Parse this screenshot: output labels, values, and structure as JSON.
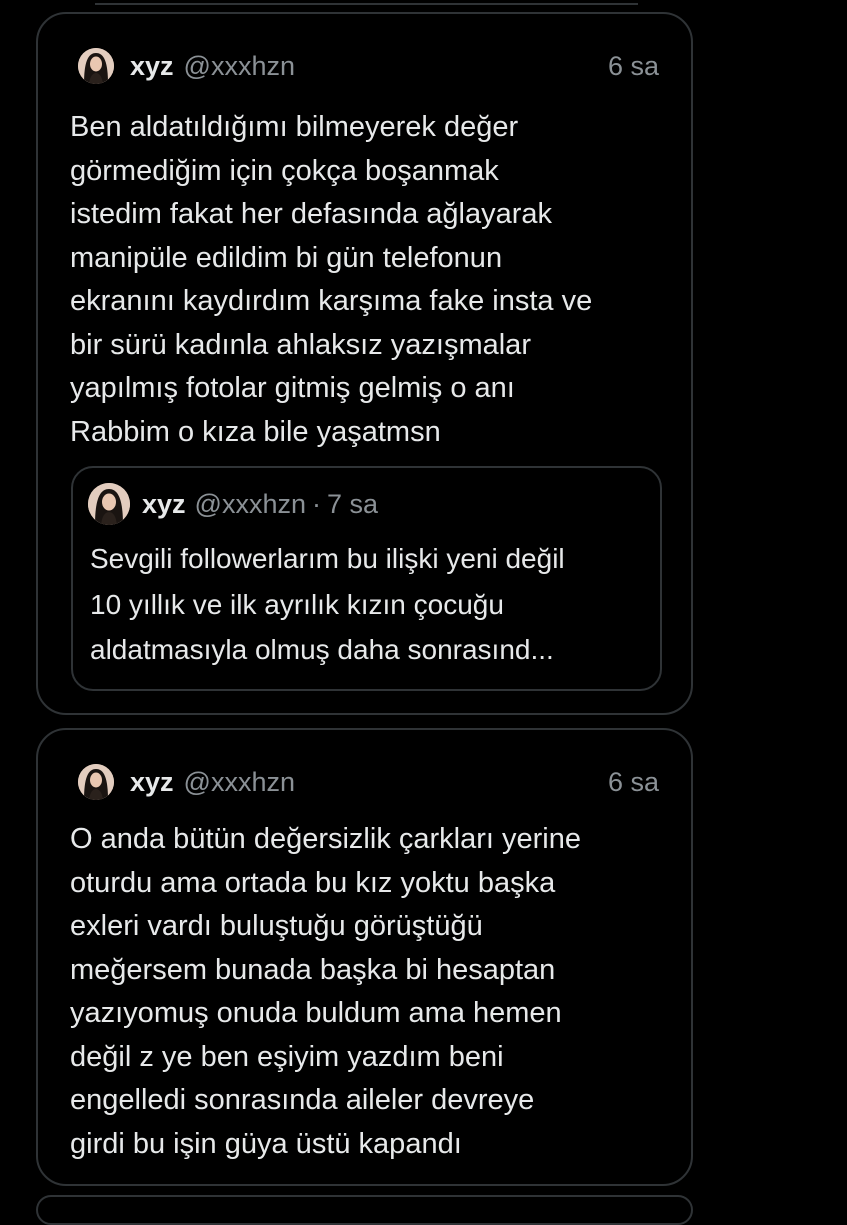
{
  "tweets": [
    {
      "display_name": "xyz",
      "handle": "@xxxhzn",
      "time": "6 sa",
      "text": "Ben aldatıldığımı bilmeyerek değer\ngörmediğim için çokça boşanmak\nistedim fakat her defasında ağlayarak\nmanipüle edildim bi gün telefonun\nekranını kaydırdım karşıma fake insta ve\nbir sürü kadınla ahlaksız yazışmalar\nyapılmış fotolar gitmiş gelmiş o anı\nRabbim o kıza bile yaşatmsn",
      "quote": {
        "display_name": "xyz",
        "handle": "@xxxhzn",
        "separator": "·",
        "time": "7 sa",
        "text": "Sevgili followerlarım bu ilişki yeni değil\n10 yıllık ve ilk ayrılık kızın çocuğu\naldatmasıyla olmuş daha sonrasınd..."
      }
    },
    {
      "display_name": "xyz",
      "handle": "@xxxhzn",
      "time": "6 sa",
      "text": "O anda bütün değersizlik çarkları yerine\noturdu ama ortada bu kız yoktu başka\nexleri vardı buluştuğu görüştüğü\nmeğersem bunada başka bi hesaptan\nyazıyomuş onuda buldum ama hemen\ndeğil z ye ben eşiyim yazdım beni\nengelledi sonrasında aileler devreye\ngirdi bu işin güya üstü kapandı"
    }
  ],
  "colors": {
    "background": "#000000",
    "border": "#2f3336",
    "text_primary": "#e7e9ea",
    "text_secondary": "#8b9196"
  },
  "icons": {
    "avatar": "profile-photo"
  }
}
